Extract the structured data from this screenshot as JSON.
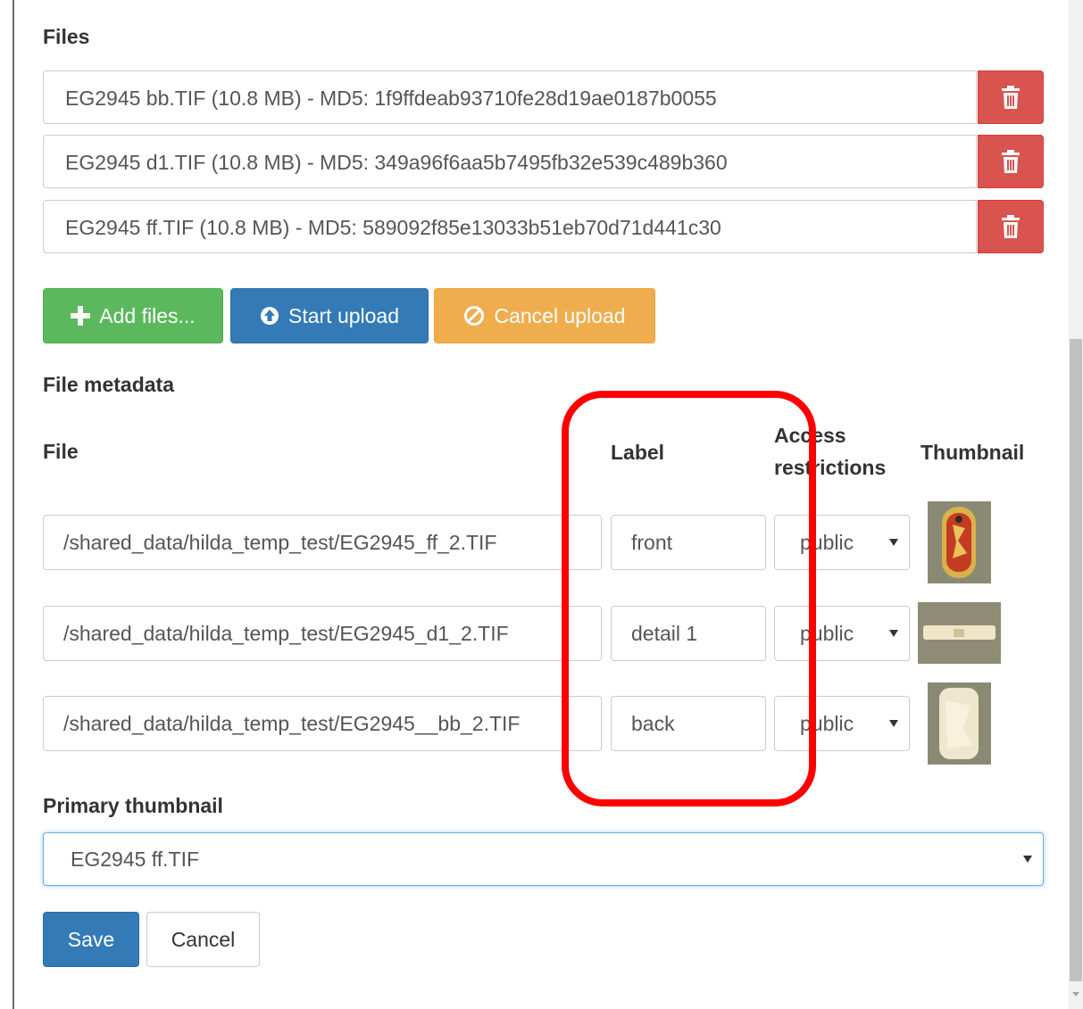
{
  "files_section": {
    "heading": "Files",
    "files": [
      {
        "text": "EG2945 bb.TIF (10.8 MB) - MD5: 1f9ffdeab93710fe28d19ae0187b0055"
      },
      {
        "text": "EG2945 d1.TIF (10.8 MB) - MD5: 349a96f6aa5b7495fb32e539c489b360"
      },
      {
        "text": "EG2945 ff.TIF (10.8 MB) - MD5: 589092f85e13033b51eb70d71d441c30"
      }
    ],
    "delete_icon": "trash-icon"
  },
  "upload_buttons": {
    "add_label": "Add files...",
    "start_label": "Start upload",
    "cancel_label": "Cancel upload"
  },
  "metadata": {
    "heading": "File metadata",
    "columns": {
      "file": "File",
      "label": "Label",
      "access": "Access restrictions",
      "thumbnail": "Thumbnail"
    },
    "rows": [
      {
        "path": "/shared_data/hilda_temp_test/EG2945_ff_2.TIF",
        "label": "front",
        "access": "public"
      },
      {
        "path": "/shared_data/hilda_temp_test/EG2945_d1_2.TIF",
        "label": "detail 1",
        "access": "public"
      },
      {
        "path": "/shared_data/hilda_temp_test/EG2945__bb_2.TIF",
        "label": "back",
        "access": "public"
      }
    ]
  },
  "primary_thumbnail": {
    "heading": "Primary thumbnail",
    "value": "EG2945 ff.TIF"
  },
  "actions": {
    "save_label": "Save",
    "cancel_label": "Cancel"
  },
  "colors": {
    "danger": "#d9534f",
    "success": "#5cb85c",
    "primary": "#337ab7",
    "warning": "#f0ad4e",
    "annotation": "#ff0000"
  }
}
